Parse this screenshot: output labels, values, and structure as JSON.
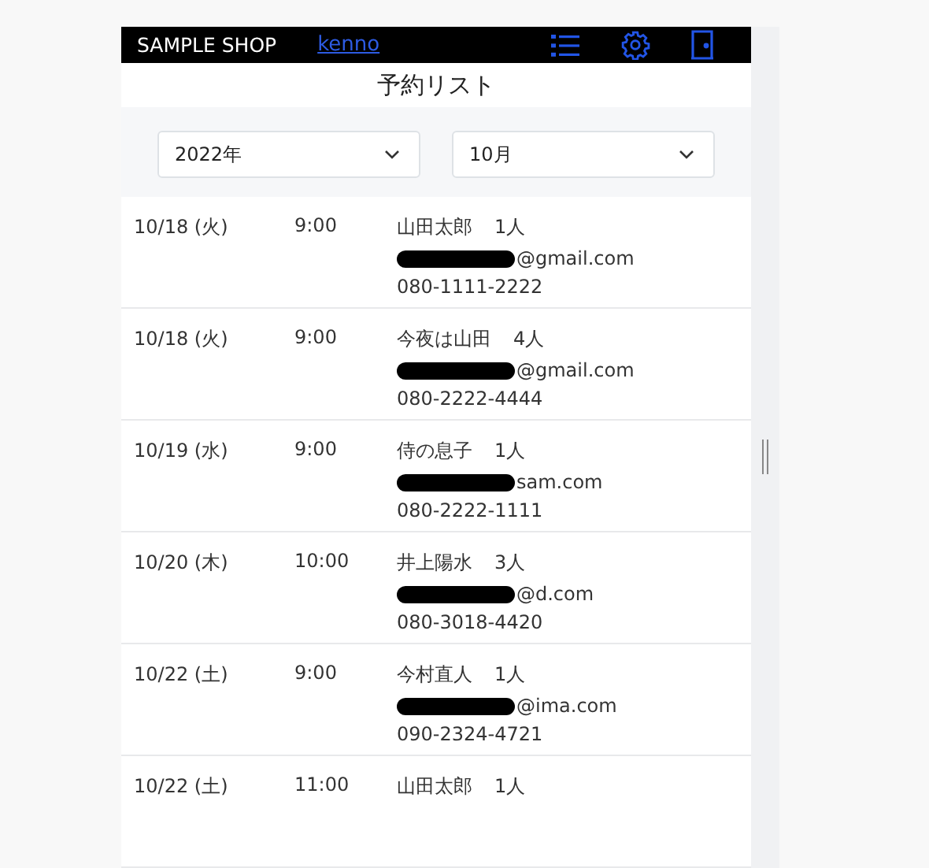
{
  "header": {
    "shop_name": "SAMPLE SHOP",
    "user_link": "kenno"
  },
  "title": "予約リスト",
  "filters": {
    "year": {
      "value": "2022年"
    },
    "month": {
      "value": "10月"
    }
  },
  "reservations": [
    {
      "date": "10/18 (火)",
      "time": "9:00",
      "name": "山田太郎",
      "people": "1人",
      "email": "@gmail.com",
      "phone": "080-1111-2222"
    },
    {
      "date": "10/18 (火)",
      "time": "9:00",
      "name": "今夜は山田",
      "people": "4人",
      "email": "@gmail.com",
      "phone": "080-2222-4444"
    },
    {
      "date": "10/19 (水)",
      "time": "9:00",
      "name": "侍の息子",
      "people": "1人",
      "email": "sam.com",
      "phone": "080-2222-1111"
    },
    {
      "date": "10/20 (木)",
      "time": "10:00",
      "name": "井上陽水",
      "people": "3人",
      "email": "@d.com",
      "phone": "080-3018-4420"
    },
    {
      "date": "10/22 (土)",
      "time": "9:00",
      "name": "今村直人",
      "people": "1人",
      "email": "@ima.com",
      "phone": "090-2324-4721"
    },
    {
      "date": "10/22 (土)",
      "time": "11:00",
      "name": "山田太郎",
      "people": "1人"
    }
  ]
}
